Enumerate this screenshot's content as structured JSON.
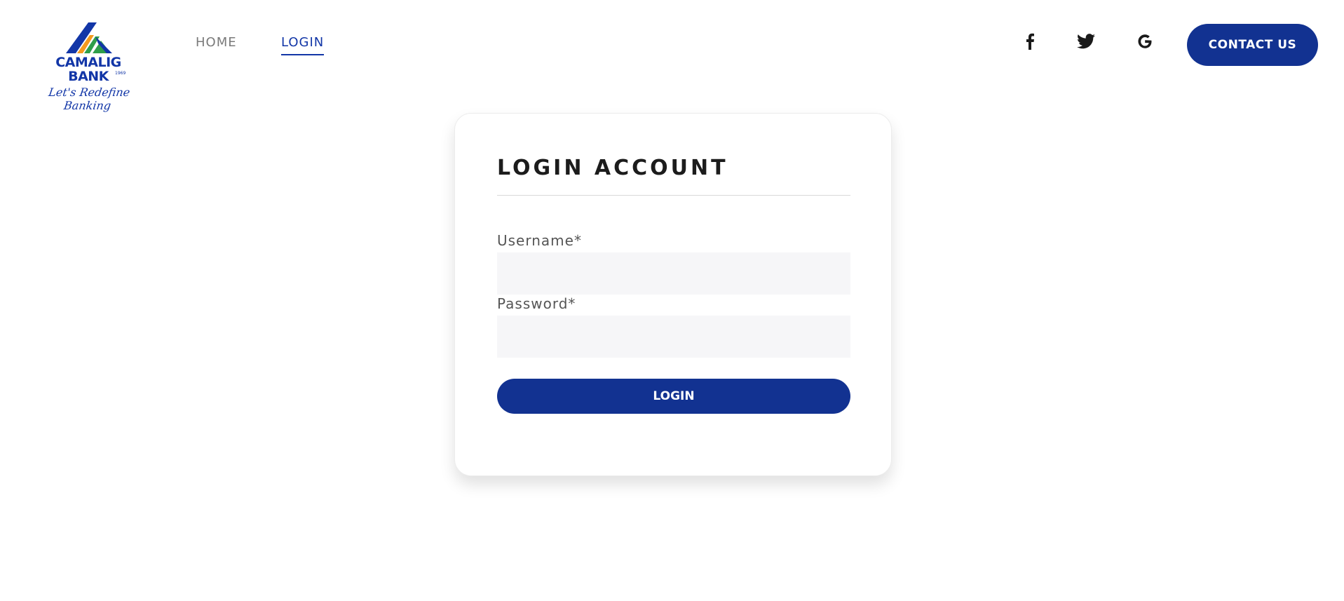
{
  "brand": {
    "name_line1": "CAMALIG",
    "name_line2": "BANK",
    "year": "1969",
    "tagline": "Let's Redefine Banking",
    "colors": {
      "primary": "#1236a7",
      "orange": "#f39a1e",
      "green": "#2e9e4a",
      "blue": "#1236a7"
    }
  },
  "nav": {
    "items": [
      {
        "label": "HOME",
        "active": false
      },
      {
        "label": "LOGIN",
        "active": true
      }
    ]
  },
  "social": {
    "icons": [
      "facebook-icon",
      "twitter-icon",
      "google-icon"
    ]
  },
  "header": {
    "contact_label": "CONTACT US"
  },
  "login_form": {
    "title": "LOGIN ACCOUNT",
    "username_label": "Username*",
    "username_value": "",
    "password_label": "Password*",
    "password_value": "",
    "submit_label": "LOGIN"
  },
  "colors": {
    "button_bg": "#123291",
    "input_bg": "#f6f6f8",
    "active_nav": "#1236a7",
    "inactive_nav": "#7a7a7a"
  }
}
